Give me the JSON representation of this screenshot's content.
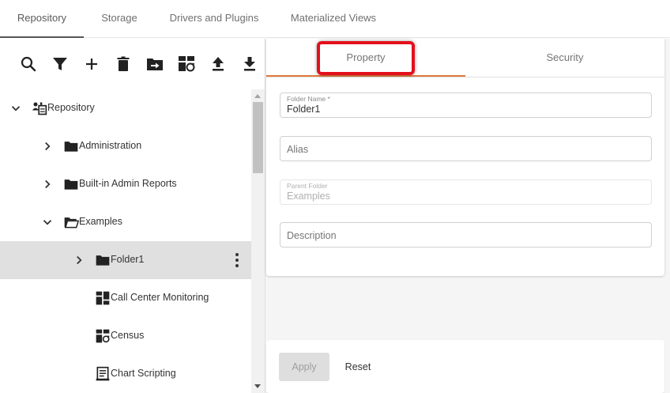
{
  "top_tabs": [
    {
      "label": "Repository",
      "active": true
    },
    {
      "label": "Storage",
      "active": false
    },
    {
      "label": "Drivers and Plugins",
      "active": false
    },
    {
      "label": "Materialized Views",
      "active": false
    }
  ],
  "toolbar": {
    "icons": [
      "search-icon",
      "filter-icon",
      "add-icon",
      "delete-icon",
      "move-folder-icon",
      "refresh-dashboard-icon",
      "upload-icon",
      "download-icon"
    ]
  },
  "tree": {
    "items": [
      {
        "label": "Repository",
        "icon": "repository-icon",
        "expanded": true
      },
      {
        "label": "Administration",
        "icon": "folder-icon",
        "expanded": false
      },
      {
        "label": "Built-in Admin Reports",
        "icon": "folder-icon",
        "expanded": false
      },
      {
        "label": "Examples",
        "icon": "folder-open-icon",
        "expanded": true
      },
      {
        "label": "Folder1",
        "icon": "folder-icon",
        "expanded": false,
        "selected": true
      },
      {
        "label": "Call Center Monitoring",
        "icon": "dashboard-icon"
      },
      {
        "label": "Census",
        "icon": "dashboard-refresh-icon"
      },
      {
        "label": "Chart Scripting",
        "icon": "script-icon"
      }
    ]
  },
  "sub_tabs": [
    {
      "label": "Property",
      "active": true
    },
    {
      "label": "Security",
      "active": false
    }
  ],
  "form": {
    "folder_name": {
      "label": "Folder Name *",
      "value": "Folder1"
    },
    "alias": {
      "placeholder": "Alias"
    },
    "parent_folder": {
      "label": "Parent Folder",
      "value": "Examples"
    },
    "description": {
      "placeholder": "Description"
    }
  },
  "actions": {
    "apply_label": "Apply",
    "reset_label": "Reset"
  },
  "colors": {
    "active_tab_underline": "#e07a3d",
    "highlight_box": "#e3101c",
    "selected_row": "#e0e0e0"
  }
}
